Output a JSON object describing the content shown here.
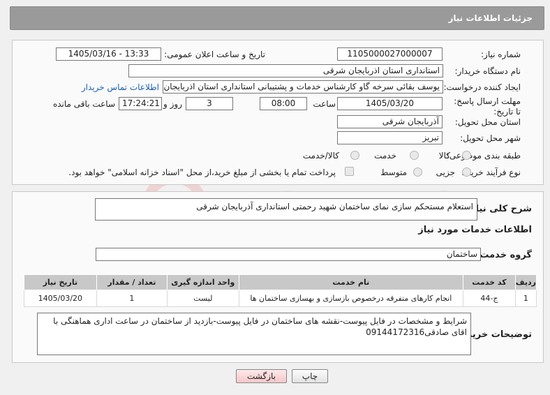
{
  "header": {
    "title": "جزئیات اطلاعات نیاز"
  },
  "form": {
    "need_number_label": "شماره نیاز:",
    "need_number": "1105000027000007",
    "announce_label": "تاریخ و ساعت اعلان عمومی:",
    "announce_value": "1405/03/16 - 13:33",
    "buyer_org_label": "نام دستگاه خریدار:",
    "buyer_org": "استانداری استان اذربایجان شرقی",
    "requester_label": "ایجاد کننده درخواست:",
    "requester": "یوسف بقائی سرخه گاو کارشناس خدمات و پشتیبانی استانداری استان اذربایجان",
    "contact_link": "اطلاعات تماس خریدار",
    "deadline_label": "مهلت ارسال پاسخ: تا تاریخ:",
    "deadline_date": "1405/03/20",
    "time_label": "ساعت",
    "deadline_time": "08:00",
    "days_value": "3",
    "days_label": "روز و",
    "remaining_time": "17:24:21",
    "remaining_label": "ساعت باقی مانده",
    "province_label": "استان محل تحویل:",
    "province": "آذربایجان شرقی",
    "city_label": "شهر محل تحویل:",
    "city": "تبریز",
    "category_label": "طبقه بندی موضوعی:",
    "category_options": [
      "کالا",
      "خدمت",
      "کالا/خدمت"
    ],
    "process_label": "نوع فرآیند خرید :",
    "process_options": [
      "جزیی",
      "متوسط"
    ],
    "payment_note": "پرداخت تمام یا بخشی از مبلغ خرید،از محل \"اسناد خزانه اسلامی\" خواهد بود."
  },
  "details": {
    "summary_label": "شرح کلی نیاز:",
    "summary": "استعلام مستحکم سازی نمای ساختمان شهید رحمتی استانداری آذربایجان شرقی",
    "services_title": "اطلاعات خدمات مورد نیاز",
    "service_group_label": "گروه خدمت:",
    "service_group": "ساختمان",
    "table": {
      "headers": [
        "ردیف",
        "کد خدمت",
        "نام خدمت",
        "واحد اندازه گیری",
        "تعداد / مقدار",
        "تاریخ نیاز"
      ],
      "rows": [
        [
          "1",
          "ج-44",
          "انجام کارهای متفرقه درخصوص بازسازی و بهسازی ساختمان ها",
          "لیست",
          "1",
          "1405/03/20"
        ]
      ]
    },
    "buyer_notes_label": "توضیحات خریدار:",
    "buyer_notes": "شرایط و مشخصات در فایل پیوست-نقشه های ساختمان در فایل پیوست-بازدید از ساختمان در ساعت اداری هماهنگی با اقای صادقی09144172316"
  },
  "buttons": {
    "print": "چاپ",
    "back": "بازگشت"
  },
  "colors": {
    "header": "#9a9a9a",
    "link": "#1a5fb4",
    "back_button": "#f6c7c9",
    "watermark": "#e8c9c9"
  },
  "watermark_text": "AriaTender.neT"
}
